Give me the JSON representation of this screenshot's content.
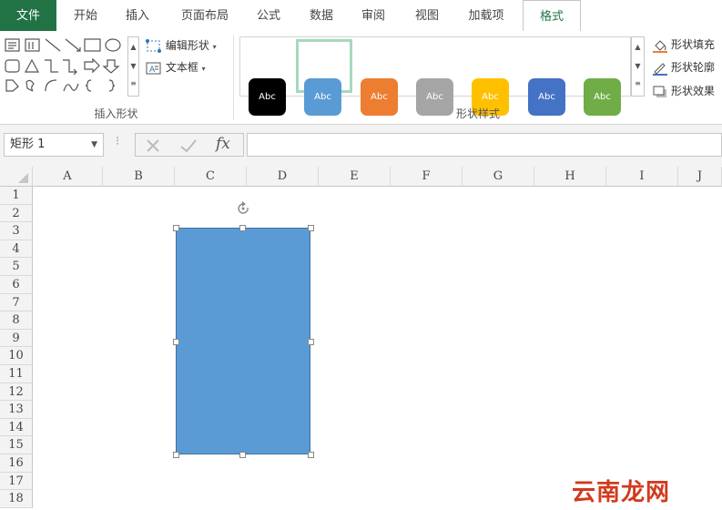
{
  "tabs": {
    "file": "文件",
    "home": "开始",
    "insert": "插入",
    "layout": "页面布局",
    "formulas": "公式",
    "data": "数据",
    "review": "审阅",
    "view": "视图",
    "addins": "加载项",
    "format": "格式"
  },
  "ribbon": {
    "edit_shape": "编辑形状",
    "text_box": "文本框",
    "group_insert_shapes": "插入形状",
    "group_shape_styles": "形状样式",
    "style_preview_text": "Abc",
    "style_swatches": [
      {
        "color": "#000000",
        "text_color": "#ffffff"
      },
      {
        "color": "#5b9bd5",
        "text_color": "#ffffff"
      },
      {
        "color": "#ed7d31",
        "text_color": "#ffffff"
      },
      {
        "color": "#a5a5a5",
        "text_color": "#ffffff"
      },
      {
        "color": "#ffc000",
        "text_color": "#ffffff"
      },
      {
        "color": "#4472c4",
        "text_color": "#ffffff"
      },
      {
        "color": "#70ad47",
        "text_color": "#ffffff"
      }
    ],
    "shape_fill": "形状填充",
    "shape_outline": "形状轮廓",
    "shape_effects": "形状效果"
  },
  "formula_bar": {
    "name_box": "矩形 1",
    "formula": ""
  },
  "columns": [
    "A",
    "B",
    "C",
    "D",
    "E",
    "F",
    "G",
    "H",
    "I",
    "J"
  ],
  "rows": [
    "1",
    "2",
    "3",
    "4",
    "5",
    "6",
    "7",
    "8",
    "9",
    "10",
    "11",
    "12",
    "13",
    "14",
    "15",
    "16",
    "17",
    "18"
  ],
  "shape": {
    "fill": "#5b9bd5",
    "border": "#41719c"
  },
  "watermark": "云南龙网",
  "colors": {
    "accent": "#217346",
    "selection_frame": "#a6d9bd"
  }
}
